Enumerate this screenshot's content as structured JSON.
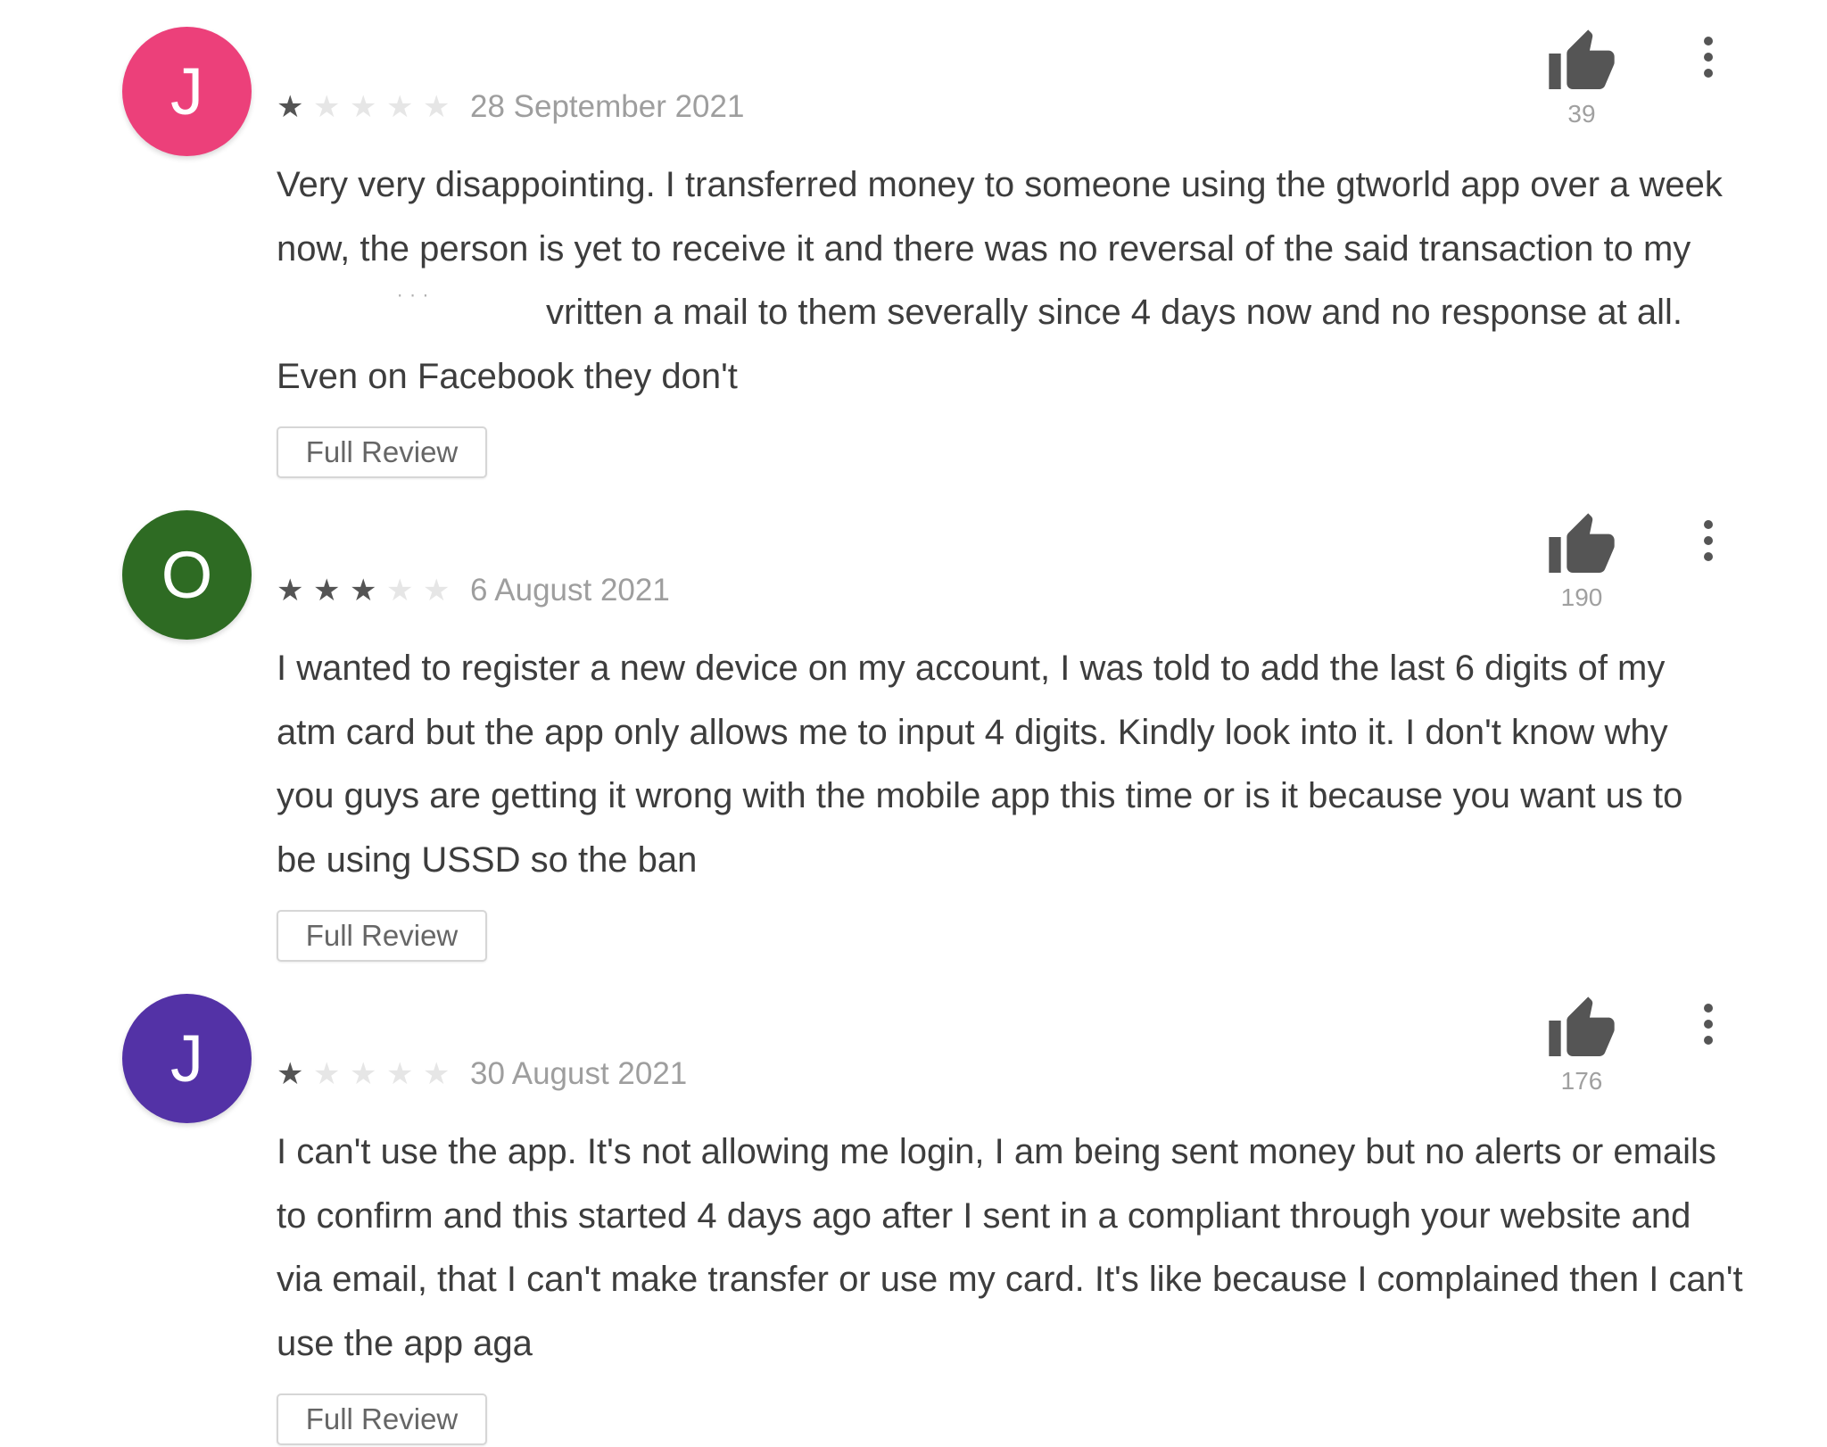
{
  "reviews": [
    {
      "avatar_letter": "J",
      "avatar_color": "#ec407a",
      "rating": 1,
      "rating_max": 5,
      "date": "28 September 2021",
      "helpful_count": "39",
      "text_lines": [
        "Very very disappointing. I transferred money to someone using the gtworld app over a week",
        "now, the person is yet to receive it and there was no reversal of the said transaction to my",
        "vritten a mail to them severally since 4 days now and no response at all.",
        "Even on Facebook they don't"
      ],
      "full_review_label": "Full Review"
    },
    {
      "avatar_letter": "O",
      "avatar_color": "#2e6b23",
      "rating": 3,
      "rating_max": 5,
      "date": "6 August 2021",
      "helpful_count": "190",
      "text_lines": [
        "I wanted to register a new device on my account, I was told to add the last 6 digits of my",
        "atm card but the app only allows me to input 4 digits. Kindly look into it. I don't know why",
        "you guys are getting it wrong with the mobile app this time or is it because you want us to",
        "be using USSD so the ban"
      ],
      "full_review_label": "Full Review"
    },
    {
      "avatar_letter": "J",
      "avatar_color": "#5332a6",
      "rating": 1,
      "rating_max": 5,
      "date": "30 August 2021",
      "helpful_count": "176",
      "text_lines": [
        "I can't use the app. It's not allowing me login, I am being sent money but no alerts or emails",
        "to confirm and this started 4 days ago after I sent in a compliant through your website and",
        "via email, that I can't make transfer or use my card. It's like because I complained then I can't",
        "use the app aga"
      ],
      "full_review_label": "Full Review"
    }
  ],
  "icons": {
    "helpful": "thumbs-up-icon",
    "more": "more-vert-icon",
    "star": "star-icon"
  },
  "colors": {
    "star_filled": "#545454",
    "star_empty": "#e6e6e6",
    "icon": "#555555"
  }
}
